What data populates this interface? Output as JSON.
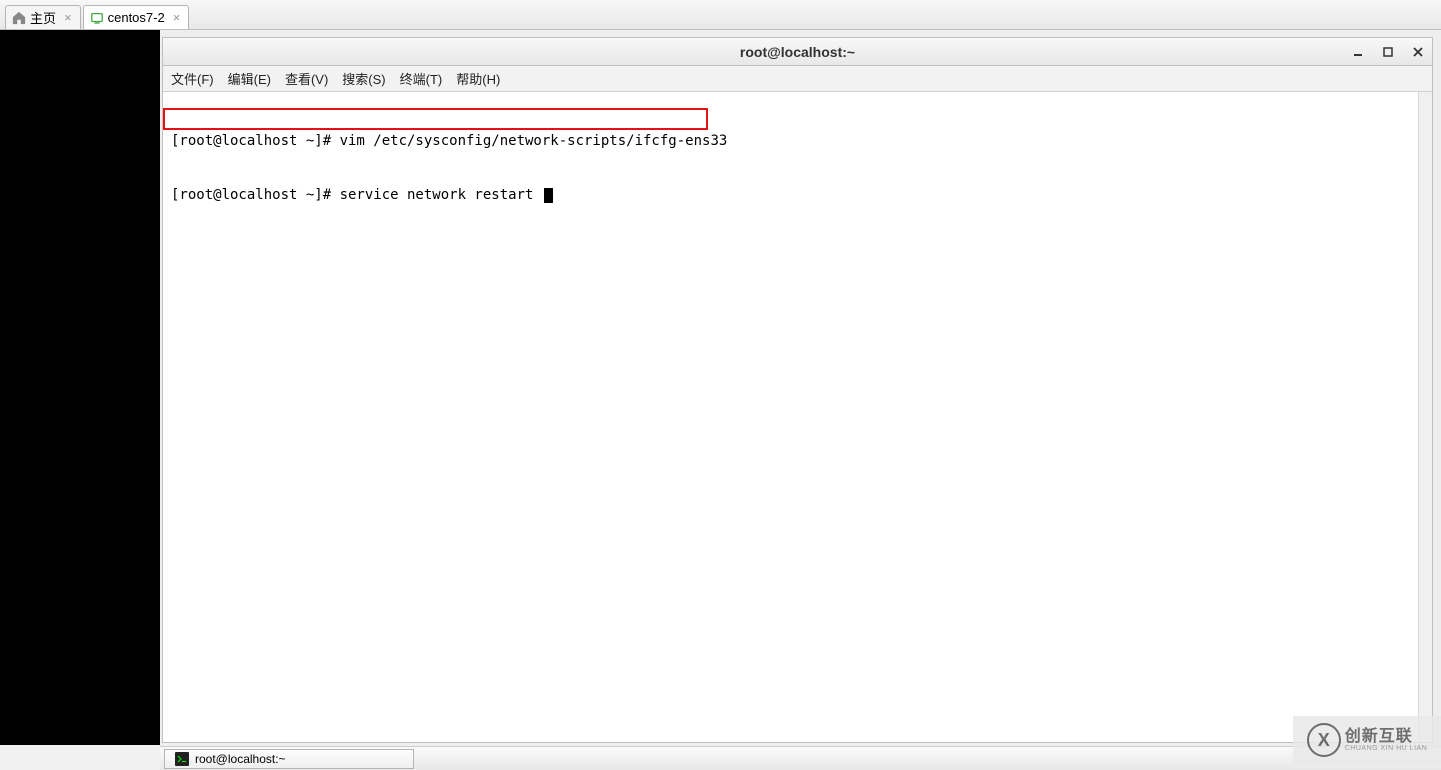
{
  "tabs": {
    "home": {
      "label": "主页"
    },
    "vm": {
      "label": "centos7-2"
    }
  },
  "terminal": {
    "title": "root@localhost:~",
    "menu": {
      "file": "文件(F)",
      "edit": "编辑(E)",
      "view": "查看(V)",
      "search": "搜索(S)",
      "terminal": "终端(T)",
      "help": "帮助(H)"
    },
    "lines": {
      "l1": "[root@localhost ~]# vim /etc/sysconfig/network-scripts/ifcfg-ens33",
      "l2": "[root@localhost ~]# service network restart "
    }
  },
  "taskbar": {
    "app": "root@localhost:~"
  },
  "watermark": {
    "brand_cn": "创新互联",
    "brand_en": "CHUANG XIN HU LIAN"
  }
}
